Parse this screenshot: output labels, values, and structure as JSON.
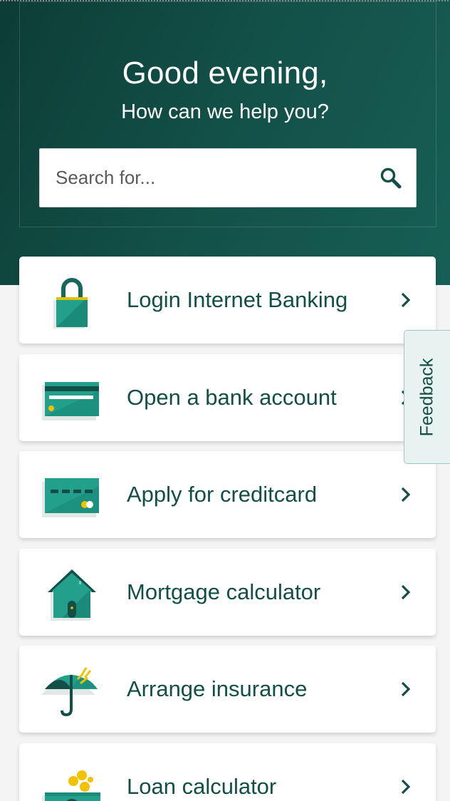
{
  "header": {
    "greeting": "Good evening,",
    "subtitle": "How can we help you?"
  },
  "search": {
    "placeholder": "Search for...",
    "icon": "search-icon"
  },
  "cards": [
    {
      "label": "Login Internet Banking",
      "icon": "lock-icon"
    },
    {
      "label": "Open a bank account",
      "icon": "bank-card-icon"
    },
    {
      "label": "Apply for creditcard",
      "icon": "credit-card-icon"
    },
    {
      "label": "Mortgage calculator",
      "icon": "house-icon"
    },
    {
      "label": "Arrange insurance",
      "icon": "umbrella-icon"
    },
    {
      "label": "Loan calculator",
      "icon": "money-coins-icon"
    }
  ],
  "feedback": {
    "label": "Feedback"
  },
  "colors": {
    "brand_dark": "#0c3d36",
    "brand": "#134f47",
    "accent": "#1fa08d",
    "highlight": "#f2c200"
  }
}
